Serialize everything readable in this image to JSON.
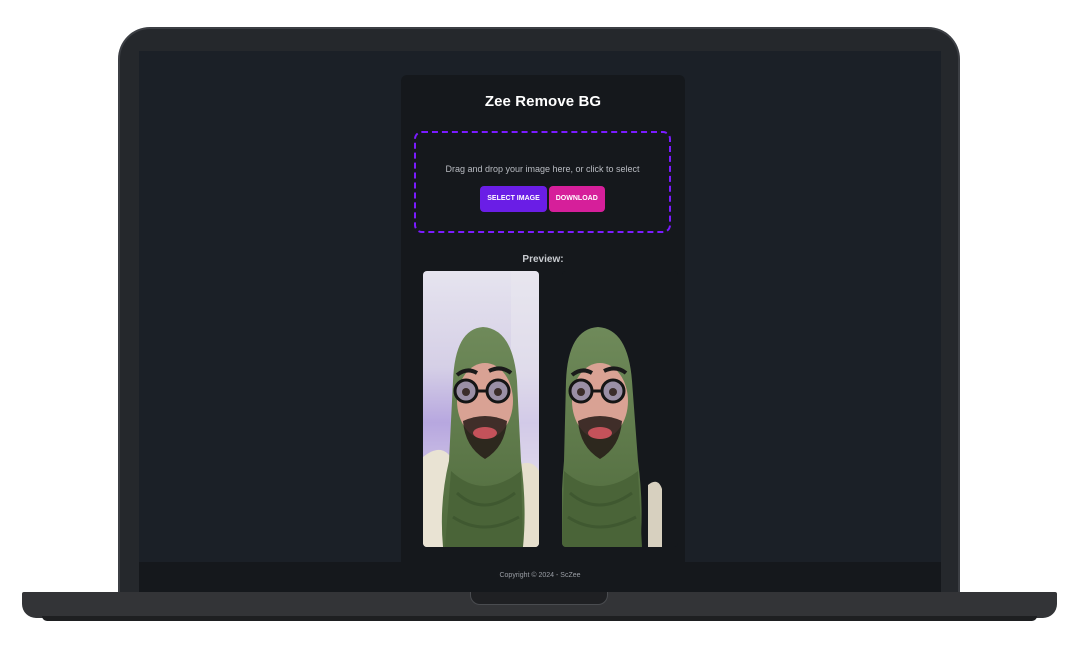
{
  "app": {
    "title": "Zee Remove BG"
  },
  "upload": {
    "instruction": "Drag and drop your image here, or click to select",
    "select_label": "SELECT IMAGE",
    "download_label": "DOWNLOAD"
  },
  "preview": {
    "label": "Preview:",
    "images": [
      {
        "name": "original-image"
      },
      {
        "name": "background-removed-image"
      }
    ]
  },
  "footer": {
    "copyright": "Copyright © 2024 - ScZee"
  },
  "colors": {
    "accent_border": "#7a1bff",
    "select_button": "#6a1ee6",
    "download_button": "#d61f9a",
    "card_bg": "#15181c",
    "page_bg": "#1b2027"
  }
}
